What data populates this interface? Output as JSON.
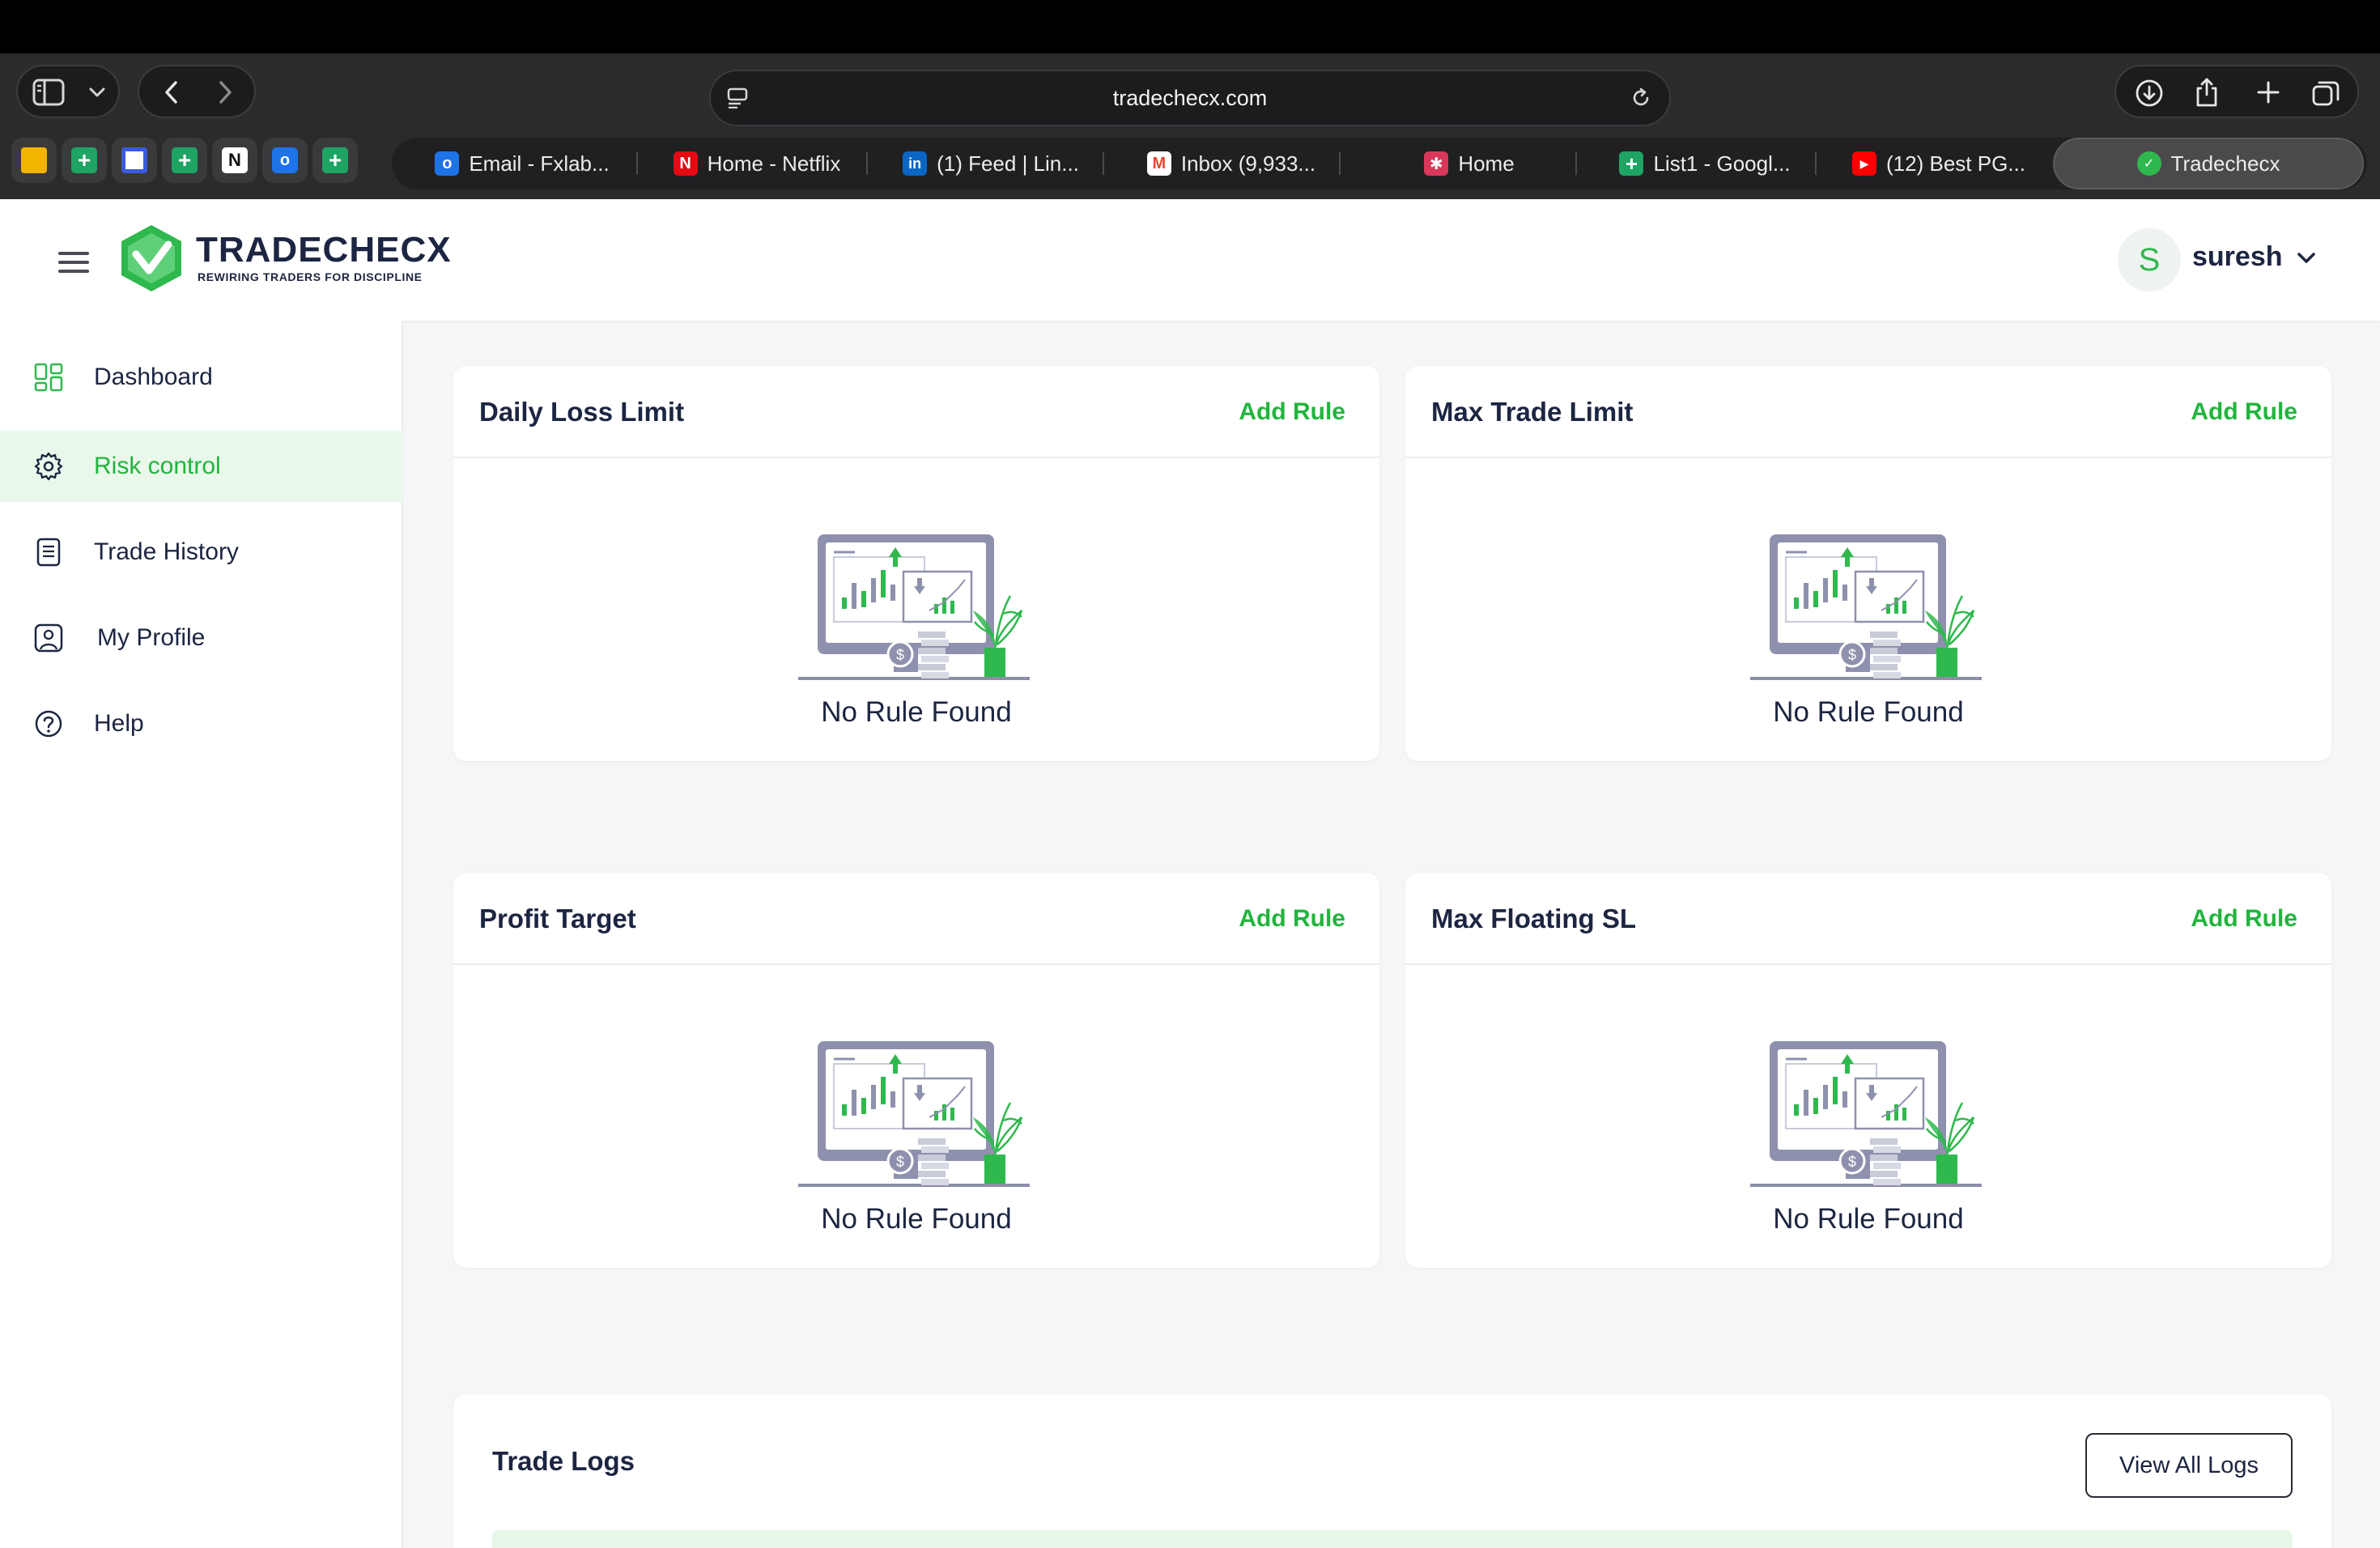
{
  "browser": {
    "url": "tradechecx.com",
    "tabs": [
      {
        "label": "Email - Fxlab...",
        "icon": "outlook-icon",
        "color": "#1e73e8"
      },
      {
        "label": "Home - Netflix",
        "icon": "netflix-icon",
        "color": "#e50914"
      },
      {
        "label": "(1) Feed | Lin...",
        "icon": "linkedin-icon",
        "color": "#0a66c2"
      },
      {
        "label": "Inbox (9,933...",
        "icon": "gmail-icon",
        "color": "#ea4335"
      },
      {
        "label": "Home",
        "icon": "app-icon",
        "color": "#d9385a"
      },
      {
        "label": "List1 - Googl...",
        "icon": "sheets-icon",
        "color": "#1fa463"
      },
      {
        "label": "(12) Best PG...",
        "icon": "youtube-icon",
        "color": "#ff0000"
      },
      {
        "label": "Tradechecx",
        "icon": "tradechecx-icon",
        "color": "#2fb84d"
      }
    ]
  },
  "header": {
    "brand_name": "TRADECHECX",
    "brand_tagline": "REWIRING TRADERS FOR DISCIPLINE",
    "avatar_letter": "S",
    "username": "suresh"
  },
  "sidebar": {
    "items": [
      {
        "label": "Dashboard",
        "icon": "dashboard-icon"
      },
      {
        "label": "Risk control",
        "icon": "gear-icon",
        "active": true
      },
      {
        "label": "Trade History",
        "icon": "document-icon"
      },
      {
        "label": "My Profile",
        "icon": "profile-icon"
      },
      {
        "label": "Help",
        "icon": "help-icon"
      }
    ]
  },
  "cards": [
    {
      "title": "Daily Loss Limit",
      "action": "Add Rule",
      "empty": "No Rule Found"
    },
    {
      "title": "Max Trade Limit",
      "action": "Add Rule",
      "empty": "No Rule Found"
    },
    {
      "title": "Profit Target",
      "action": "Add Rule",
      "empty": "No Rule Found"
    },
    {
      "title": "Max Floating SL",
      "action": "Add Rule",
      "empty": "No Rule Found"
    }
  ],
  "trade_logs": {
    "title": "Trade Logs",
    "view_all": "View All Logs"
  },
  "colors": {
    "accent": "#22b43d",
    "text": "#1c2541",
    "active_bg": "#e9f8ea"
  }
}
